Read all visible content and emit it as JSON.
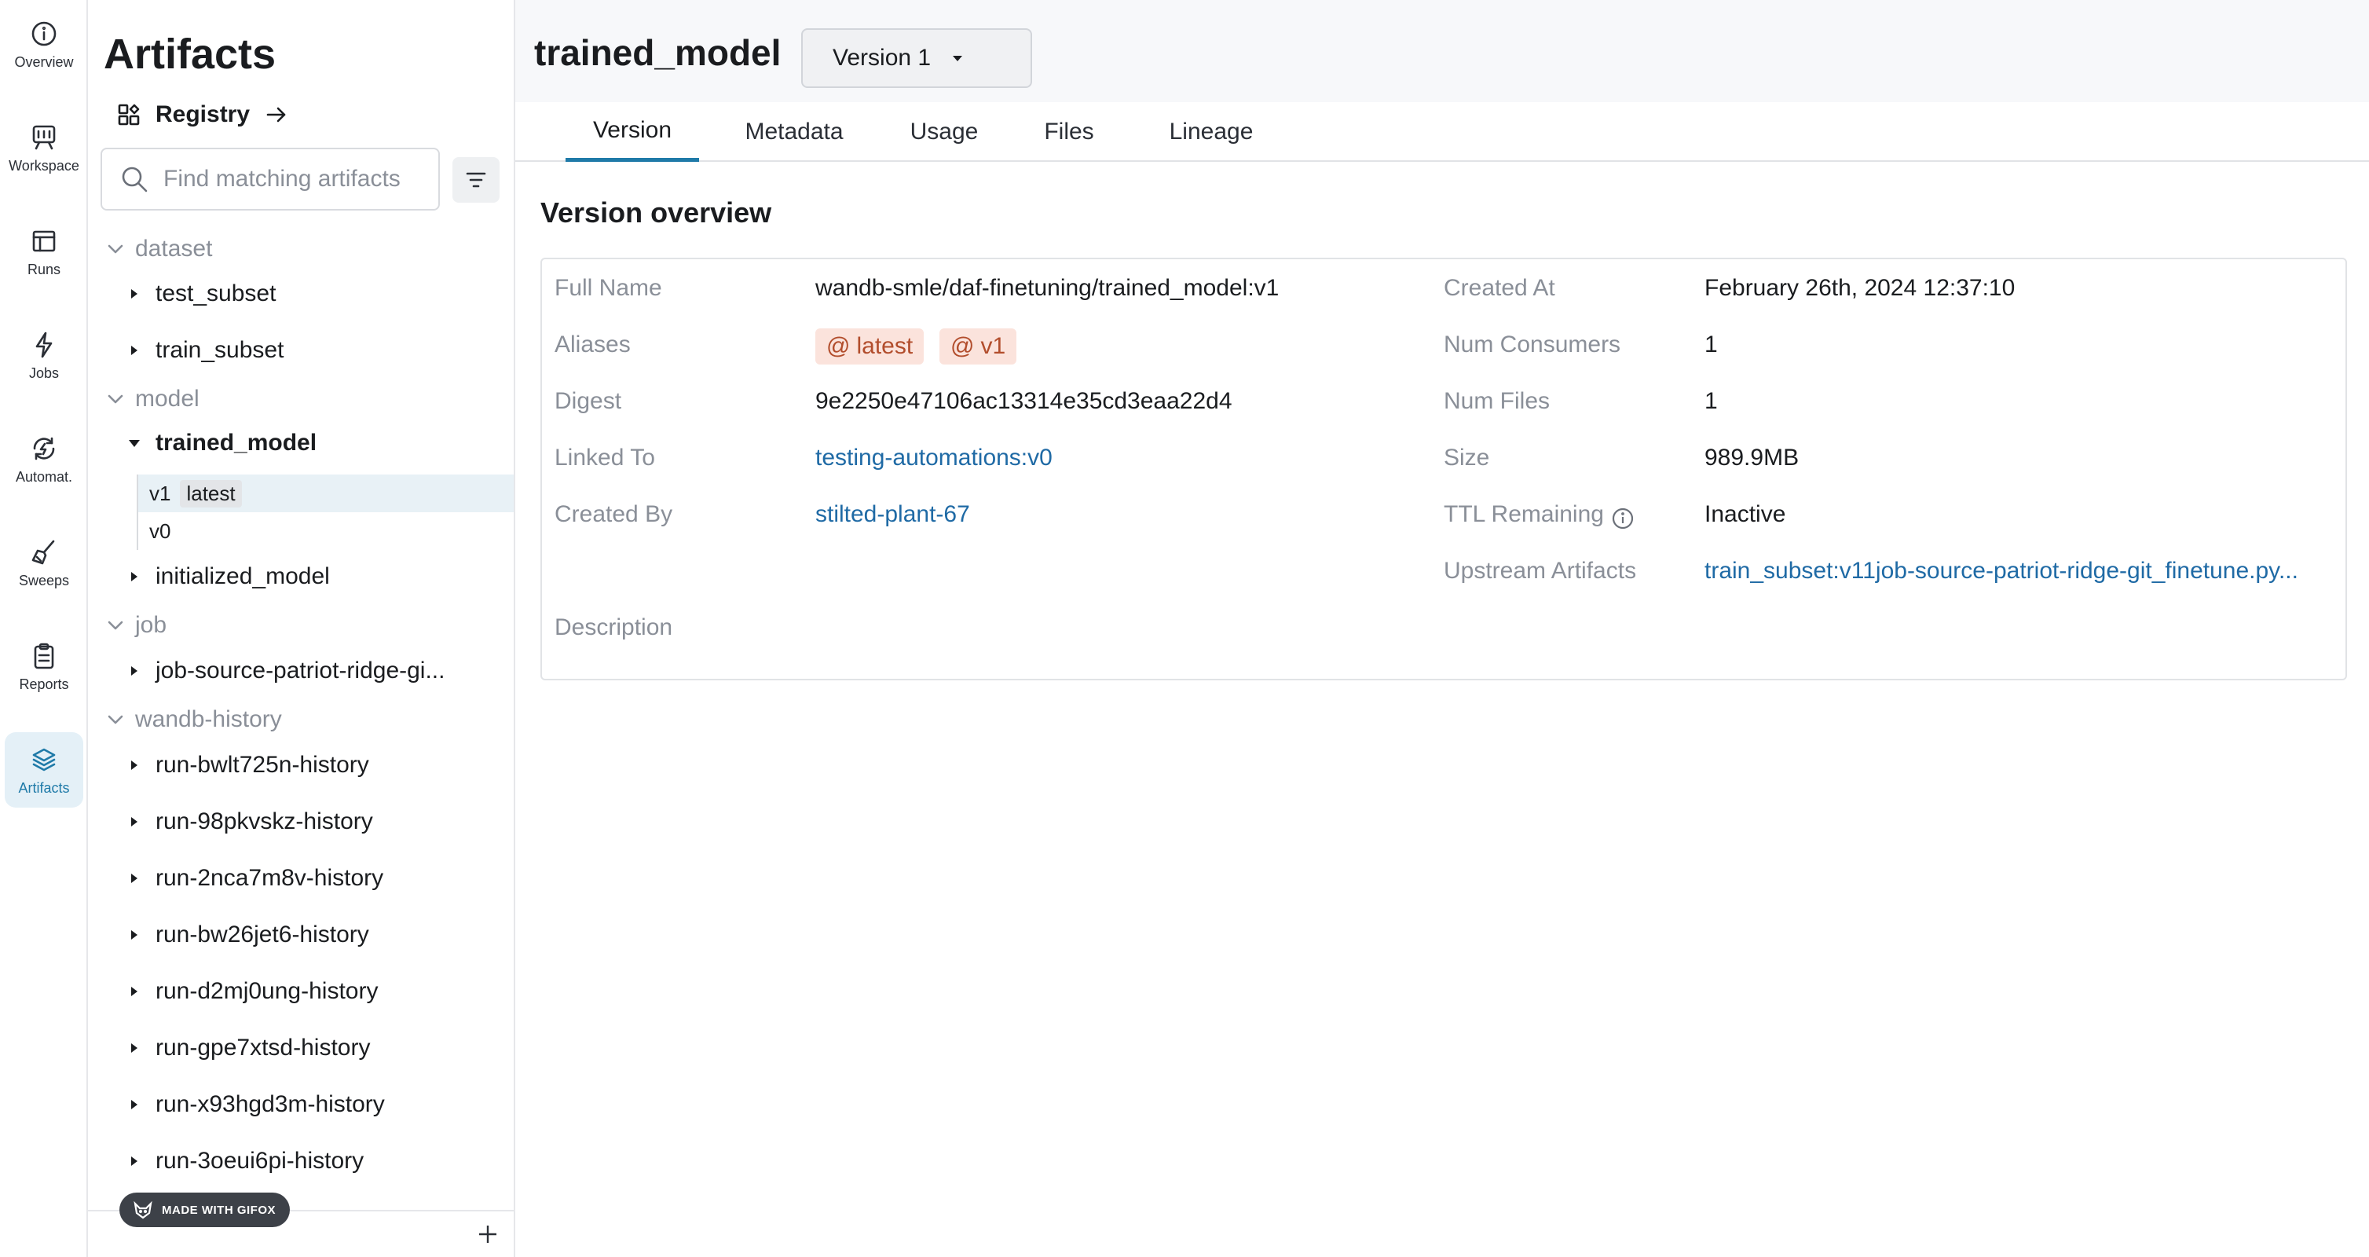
{
  "rail": {
    "items": [
      {
        "label": "Overview",
        "icon": "info-icon"
      },
      {
        "label": "Workspace",
        "icon": "workspace-icon"
      },
      {
        "label": "Runs",
        "icon": "runs-table-icon"
      },
      {
        "label": "Jobs",
        "icon": "lightning-icon"
      },
      {
        "label": "Automat.",
        "icon": "automation-icon"
      },
      {
        "label": "Sweeps",
        "icon": "broom-icon"
      },
      {
        "label": "Reports",
        "icon": "clipboard-icon"
      },
      {
        "label": "Artifacts",
        "icon": "layers-icon"
      }
    ],
    "active": "Artifacts",
    "accent_color": "#1f7aa8"
  },
  "panel": {
    "title": "Artifacts",
    "registry_label": "Registry",
    "search_placeholder": "Find matching artifacts",
    "groups": {
      "dataset": "dataset",
      "model": "model",
      "job": "job",
      "history": "wandb-history"
    },
    "dataset_items": [
      "test_subset",
      "train_subset"
    ],
    "model_items": {
      "expanded": "trained_model",
      "versions": [
        {
          "name": "v1",
          "tag": "latest"
        },
        {
          "name": "v0",
          "tag": ""
        }
      ],
      "other": "initialized_model"
    },
    "job_items": [
      "job-source-patriot-ridge-gi..."
    ],
    "history_items": [
      "run-bwlt725n-history",
      "run-98pkvskz-history",
      "run-2nca7m8v-history",
      "run-bw26jet6-history",
      "run-d2mj0ung-history",
      "run-gpe7xtsd-history",
      "run-x93hgd3m-history",
      "run-3oeui6pi-history"
    ],
    "watermark": "MADE WITH GIFOX"
  },
  "main": {
    "artifact_title": "trained_model",
    "version_select": "Version 1",
    "tabs": [
      "Version",
      "Metadata",
      "Usage",
      "Files",
      "Lineage"
    ],
    "active_tab": "Version",
    "section_title": "Version overview",
    "fields": {
      "full_name_label": "Full Name",
      "full_name": "wandb-smle/daf-finetuning/trained_model:v1",
      "aliases_label": "Aliases",
      "aliases": [
        "latest",
        "v1"
      ],
      "digest_label": "Digest",
      "digest": "9e2250e47106ac13314e35cd3eaa22d4",
      "linked_to_label": "Linked To",
      "linked_to": "testing-automations:v0",
      "created_by_label": "Created By",
      "created_by": "stilted-plant-67",
      "description_label": "Description",
      "created_at_label": "Created At",
      "created_at": "February 26th, 2024 12:37:10",
      "num_consumers_label": "Num Consumers",
      "num_consumers": "1",
      "num_files_label": "Num Files",
      "num_files": "1",
      "size_label": "Size",
      "size": "989.9MB",
      "ttl_label": "TTL Remaining",
      "ttl": "Inactive",
      "upstream_label": "Upstream Artifacts",
      "upstream": "train_subset:v11job-source-patriot-ridge-git_finetune.py..."
    },
    "alias_color": "#fbe3dc",
    "link_color": "#1f6aa5"
  }
}
